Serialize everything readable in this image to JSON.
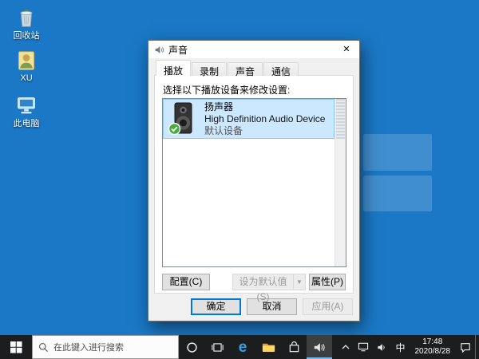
{
  "desktop": {
    "icons": [
      {
        "label": "回收站"
      },
      {
        "label": "XU"
      },
      {
        "label": "此电脑"
      }
    ]
  },
  "dialog": {
    "title": "声音",
    "close_glyph": "✕",
    "tabs": [
      {
        "label": "播放"
      },
      {
        "label": "录制"
      },
      {
        "label": "声音"
      },
      {
        "label": "通信"
      }
    ],
    "instruction": "选择以下播放设备来修改设置:",
    "device": {
      "name": "扬声器",
      "description": "High Definition Audio Device",
      "status": "默认设备"
    },
    "buttons": {
      "configure": "配置(C)",
      "set_default": "设为默认值(S)",
      "dropdown_glyph": "▼",
      "properties": "属性(P)",
      "ok": "确定",
      "cancel": "取消",
      "apply": "应用(A)"
    }
  },
  "taskbar": {
    "search": {
      "placeholder": "在此键入进行搜索"
    },
    "edge_glyph": "e",
    "tray": {
      "input_method": "中",
      "time": "17:48",
      "date": "2020/8/28"
    }
  },
  "colors": {
    "desktop_bg": "#1a78c6",
    "selection_fill": "#cce8ff",
    "selection_border": "#94cbf4",
    "accent": "#0078d7",
    "taskbar_bg": "#1c1d1f"
  }
}
